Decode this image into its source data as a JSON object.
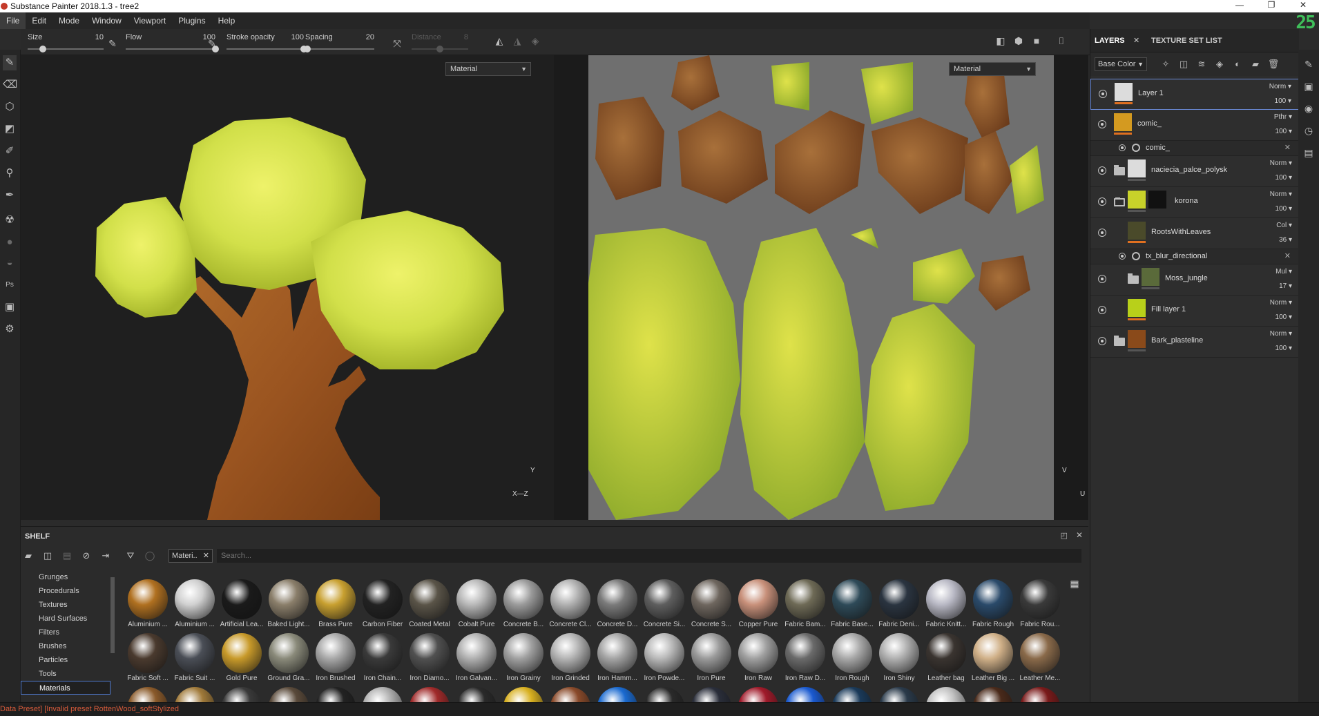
{
  "window": {
    "title": "Substance Painter 2018.1.3 - tree2",
    "controls": [
      "—",
      "❐",
      "✕"
    ]
  },
  "menu": [
    "File",
    "Edit",
    "Mode",
    "Window",
    "Viewport",
    "Plugins",
    "Help"
  ],
  "logo": "25",
  "tool_props": {
    "size": {
      "label": "Size",
      "value": "10",
      "level": 0.2
    },
    "flow": {
      "label": "Flow",
      "value": "100",
      "level": 1.0
    },
    "stroke_opacity": {
      "label": "Stroke opacity",
      "value": "100",
      "level": 1.0
    },
    "spacing": {
      "label": "Spacing",
      "value": "20",
      "level": 0.03
    },
    "distance": {
      "label": "Distance",
      "value": "8",
      "level": 0.5
    }
  },
  "viewport_3d": {
    "mode_select": "Material",
    "axis_y": "Y",
    "axis_xz": "X—Z"
  },
  "viewport_2d": {
    "mode_select": "Material",
    "axis_v": "V",
    "axis_u": "U"
  },
  "right_panel": {
    "tabs": [
      {
        "label": "LAYERS",
        "close": "✕"
      },
      {
        "label": "TEXTURE SET LIST"
      }
    ],
    "channel": "Base Color",
    "layers": [
      {
        "name": "Layer 1",
        "blend": "Norm",
        "opacity": "100",
        "thumb": "#dcdcdc",
        "kind": "paint",
        "selected": true
      },
      {
        "name": "comic_",
        "blend": "Pthr",
        "opacity": "100",
        "thumb": "#d49a20",
        "kind": "paint"
      },
      {
        "name": "comic_",
        "kind": "sub-filter"
      },
      {
        "name": "naciecia_palce_polysk",
        "blend": "Norm",
        "opacity": "100",
        "thumb": "#dcdcdc",
        "kind": "folder"
      },
      {
        "name": "korona",
        "blend": "Norm",
        "opacity": "100",
        "thumb": "#c8d22a",
        "kind": "folder-open"
      },
      {
        "name": "RootsWithLeaves",
        "blend": "Col",
        "opacity": "36",
        "thumb": "#4a4a2a",
        "kind": "fill"
      },
      {
        "name": "tx_blur_directional",
        "kind": "sub-filter"
      },
      {
        "name": "Moss_jungle",
        "blend": "Mul",
        "opacity": "17",
        "thumb": "#5a6a3a",
        "kind": "folder-nested"
      },
      {
        "name": "Fill layer 1",
        "blend": "Norm",
        "opacity": "100",
        "thumb": "#b8d01a",
        "kind": "fill"
      },
      {
        "name": "Bark_plasteline",
        "blend": "Norm",
        "opacity": "100",
        "thumb": "#8a4a1a",
        "kind": "folder"
      }
    ]
  },
  "shelf": {
    "title": "SHELF",
    "filter_chip": "Materi..",
    "search_placeholder": "Search...",
    "categories": [
      "Grunges",
      "Procedurals",
      "Textures",
      "Hard Surfaces",
      "Filters",
      "Brushes",
      "Particles",
      "Tools",
      "Materials"
    ],
    "active_category": "Materials",
    "materials_row1": [
      {
        "name": "Aluminium ...",
        "color": "#b07020"
      },
      {
        "name": "Aluminium ...",
        "color": "#d0d0d0"
      },
      {
        "name": "Artificial Lea...",
        "color": "#1a1a1a"
      },
      {
        "name": "Baked Light...",
        "color": "#8a7e6a"
      },
      {
        "name": "Brass Pure",
        "color": "#c8a030"
      },
      {
        "name": "Carbon Fiber",
        "color": "#222222"
      },
      {
        "name": "Coated Metal",
        "color": "#5a5448"
      },
      {
        "name": "Cobalt Pure",
        "color": "#b8b8b8"
      },
      {
        "name": "Concrete B...",
        "color": "#9a9a9a"
      },
      {
        "name": "Concrete Cl...",
        "color": "#b0b0b0"
      },
      {
        "name": "Concrete D...",
        "color": "#7a7a7a"
      },
      {
        "name": "Concrete Si...",
        "color": "#5e5e5e"
      },
      {
        "name": "Concrete S...",
        "color": "#6e665e"
      },
      {
        "name": "Copper Pure",
        "color": "#c8907a"
      },
      {
        "name": "Fabric Bam...",
        "color": "#6e6a56"
      },
      {
        "name": "Fabric Base...",
        "color": "#2e4a58"
      },
      {
        "name": "Fabric Deni...",
        "color": "#2a3440"
      },
      {
        "name": "Fabric Knitt...",
        "color": "#b8b8c4"
      },
      {
        "name": "Fabric Rough",
        "color": "#2a4a6a"
      },
      {
        "name": "Fabric Rou...",
        "color": "#3a3a3a"
      }
    ],
    "materials_row2": [
      {
        "name": "Fabric Soft ...",
        "color": "#4a3a2e"
      },
      {
        "name": "Fabric Suit ...",
        "color": "#4a4e56"
      },
      {
        "name": "Gold Pure",
        "color": "#c89a2a"
      },
      {
        "name": "Ground Gra...",
        "color": "#8a8a7a"
      },
      {
        "name": "Iron Brushed",
        "color": "#a8a8a8"
      },
      {
        "name": "Iron Chain...",
        "color": "#3a3a3a"
      },
      {
        "name": "Iron Diamo...",
        "color": "#505050"
      },
      {
        "name": "Iron Galvan...",
        "color": "#b0b0b0"
      },
      {
        "name": "Iron Grainy",
        "color": "#a0a0a0"
      },
      {
        "name": "Iron Grinded",
        "color": "#b4b4b4"
      },
      {
        "name": "Iron Hamm...",
        "color": "#a4a4a4"
      },
      {
        "name": "Iron Powde...",
        "color": "#b8b8b8"
      },
      {
        "name": "Iron Pure",
        "color": "#9a9a9a"
      },
      {
        "name": "Iron Raw",
        "color": "#a0a0a0"
      },
      {
        "name": "Iron Raw D...",
        "color": "#6a6a6a"
      },
      {
        "name": "Iron Rough",
        "color": "#a8a8a8"
      },
      {
        "name": "Iron Shiny",
        "color": "#b0b0b0"
      },
      {
        "name": "Leather bag",
        "color": "#3a3430"
      },
      {
        "name": "Leather Big ...",
        "color": "#d0b088"
      },
      {
        "name": "Leather Me...",
        "color": "#8a6a4a"
      }
    ],
    "materials_row3_colors": [
      "#8a5a2a",
      "#a07a3a",
      "#3a3a3a",
      "#5a4a3a",
      "#222222",
      "#b0b0b0",
      "#a02a2a",
      "#2a2a2a",
      "#d8b020",
      "#8a4a2a",
      "#1a6ad0",
      "#2a2a2a",
      "#2a2e3a",
      "#a01a2a",
      "#1a5ad0",
      "#1a3a5a",
      "#2a3a4a",
      "#c0c0c0",
      "#4a2a1a",
      "#7a1a1a"
    ]
  },
  "status": {
    "message": "Data Preset] [Invalid preset RottenWood_softStylized"
  }
}
